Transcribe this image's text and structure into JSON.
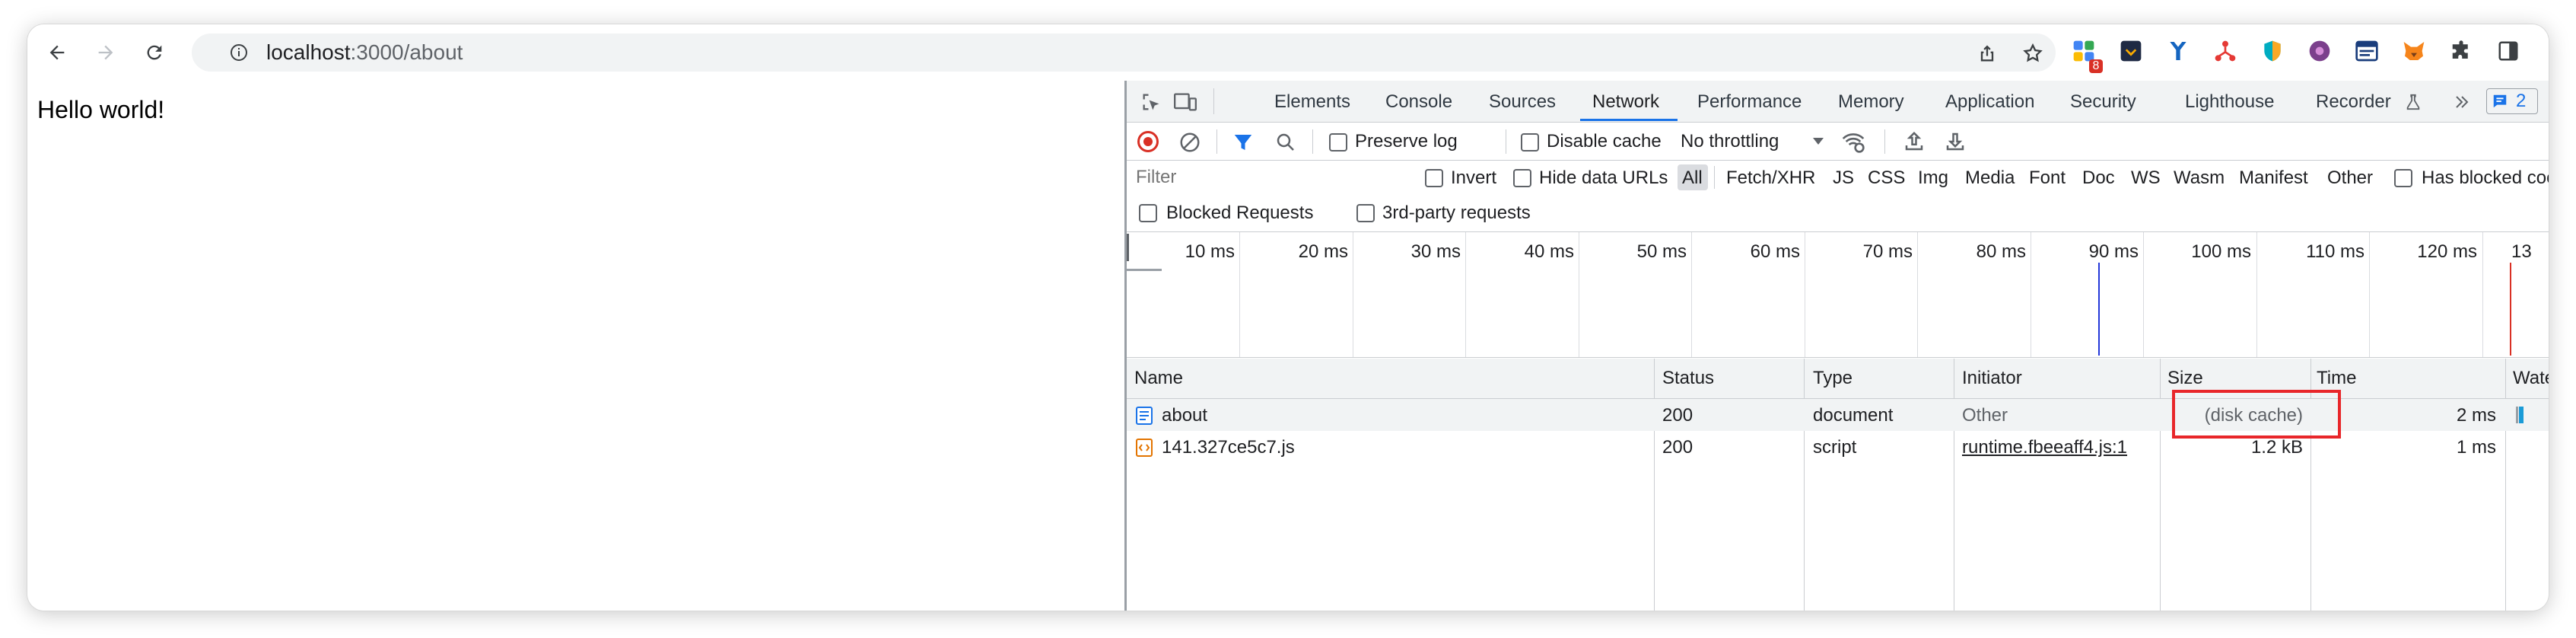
{
  "browser": {
    "url_host": "localhost",
    "url_path": ":3000/about",
    "extension_badge": "8"
  },
  "page": {
    "content_text": "Hello world!"
  },
  "devtools": {
    "tabs": [
      "Elements",
      "Console",
      "Sources",
      "Network",
      "Performance",
      "Memory",
      "Application",
      "Security",
      "Lighthouse",
      "Recorder"
    ],
    "active_tab": "Network",
    "issues_count": "2",
    "network_toolbar": {
      "preserve_log": "Preserve log",
      "disable_cache": "Disable cache",
      "throttling": "No throttling"
    },
    "filter": {
      "placeholder": "Filter",
      "invert": "Invert",
      "hide_data_urls": "Hide data URLs",
      "types": [
        "All",
        "Fetch/XHR",
        "JS",
        "CSS",
        "Img",
        "Media",
        "Font",
        "Doc",
        "WS",
        "Wasm",
        "Manifest",
        "Other"
      ],
      "active_type": "All",
      "has_blocked_cookies": "Has blocked cooki",
      "blocked_requests": "Blocked Requests",
      "third_party": "3rd-party requests"
    },
    "timeline_ticks": [
      "10 ms",
      "20 ms",
      "30 ms",
      "40 ms",
      "50 ms",
      "60 ms",
      "70 ms",
      "80 ms",
      "90 ms",
      "100 ms",
      "110 ms",
      "120 ms",
      "13"
    ],
    "columns": {
      "name": "Name",
      "status": "Status",
      "type": "Type",
      "initiator": "Initiator",
      "size": "Size",
      "time": "Time",
      "waterfall": "Waterfa"
    },
    "rows": [
      {
        "name": "about",
        "status": "200",
        "type": "document",
        "initiator": "Other",
        "size": "(disk cache)",
        "time": "2 ms",
        "icon": "document-icon"
      },
      {
        "name": "141.327ce5c7.js",
        "status": "200",
        "type": "script",
        "initiator": "runtime.fbeeaff4.js:1",
        "size": "1.2 kB",
        "time": "1 ms",
        "icon": "script-icon"
      }
    ],
    "colors": {
      "accent": "#1a73e8",
      "highlight": "#e8262a",
      "record": "#d93025"
    }
  }
}
